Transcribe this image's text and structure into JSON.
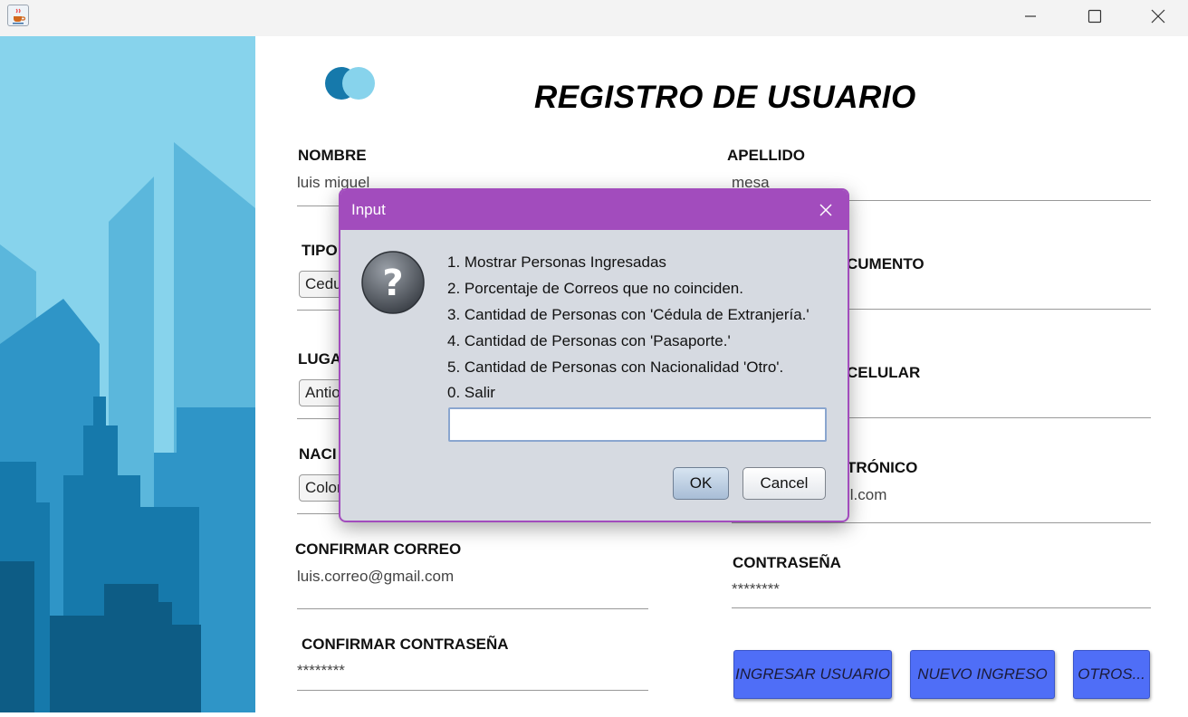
{
  "window": {
    "app_icon": "java-coffee-icon",
    "controls": [
      "minimize-icon",
      "maximize-icon",
      "close-icon"
    ]
  },
  "sidebar": {
    "illustration": "city-skyline",
    "colors": [
      "#87d3ec",
      "#5bb7dc",
      "#2f95c7",
      "#1679ab",
      "#0d5c85"
    ]
  },
  "form": {
    "title": "REGISTRO DE USUARIO",
    "nombre_label": "NOMBRE",
    "nombre_value": "luis miguel",
    "apellido_label": "APELLIDO",
    "apellido_value": "mesa",
    "tipo_label": "TIPO",
    "tipo_value": "Cedula",
    "documento_label": "CUMENTO",
    "lugar_label": "LUGA",
    "lugar_value": "Antioquia",
    "celular_label": "CELULAR",
    "nacionalidad_label": "NACI",
    "nacionalidad_value": "Colombia",
    "correo_label": "TRÓNICO",
    "correo_value": "il.com",
    "confirmar_correo_label": "CONFIRMAR CORREO",
    "confirmar_correo_value": "luis.correo@gmail.com",
    "contrasena_label": "CONTRASEÑA",
    "contrasena_value": "********",
    "confirmar_contrasena_label": "CONFIRMAR CONTRASEÑA",
    "confirmar_contrasena_value": "********",
    "buttons": {
      "ingresar": "INGRESAR USUARIO",
      "nuevo": "NUEVO INGRESO",
      "otros": "OTROS..."
    }
  },
  "dialog": {
    "title": "Input",
    "icon": "question-icon",
    "options": [
      "1. Mostrar Personas Ingresadas",
      "2. Porcentaje de Correos que no coinciden.",
      "3. Cantidad de Personas con 'Cédula de Extranjería.'",
      "4. Cantidad de Personas con 'Pasaporte.'",
      "5. Cantidad de Personas con Nacionalidad 'Otro'.",
      "0. Salir"
    ],
    "input_value": "",
    "ok_label": "OK",
    "cancel_label": "Cancel"
  },
  "colors": {
    "dialog_accent": "#a24cbd",
    "action_button": "#4f6ef7",
    "logo_dark": "#1679ab",
    "logo_light": "#87d3ec"
  }
}
